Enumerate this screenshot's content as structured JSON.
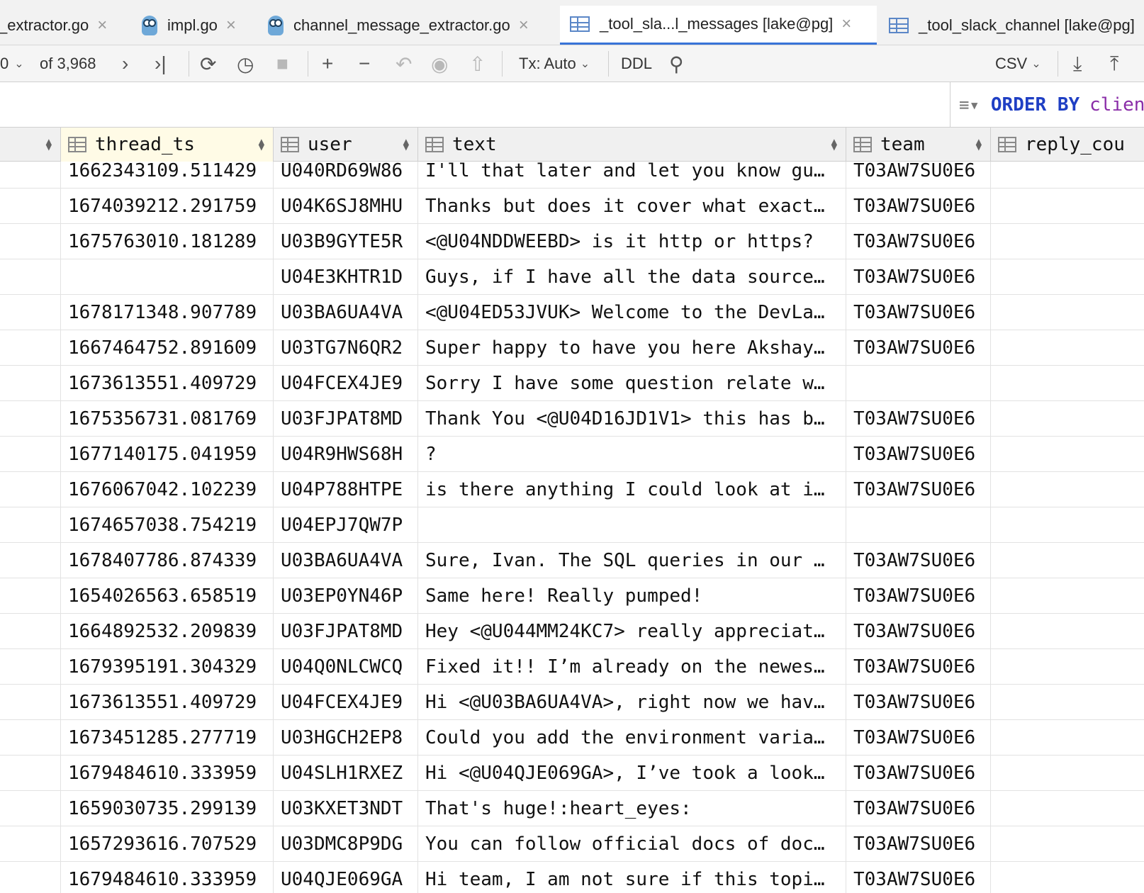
{
  "tabs": [
    {
      "label": "_extractor.go",
      "icon": "file-icon",
      "active": false
    },
    {
      "label": "impl.go",
      "icon": "gopher-icon",
      "active": false
    },
    {
      "label": "channel_message_extractor.go",
      "icon": "gopher-icon",
      "active": false
    },
    {
      "label": "_tool_sla...l_messages [lake@pg]",
      "icon": "table-icon",
      "active": true
    },
    {
      "label": "_tool_slack_channel [lake@pg]",
      "icon": "table-icon",
      "active": false
    }
  ],
  "toolbar": {
    "page_value": "0",
    "page_total": "of 3,968",
    "tx_label": "Tx: Auto",
    "ddl_label": "DDL",
    "export_format": "CSV"
  },
  "filter": {
    "order_by_keyword": "ORDER BY",
    "order_by_column": "clien"
  },
  "columns": [
    "thread_ts",
    "user",
    "text",
    "team",
    "reply_cou"
  ],
  "rows": [
    {
      "thread_ts": "1662343109.511429",
      "user": "U040RD69W86",
      "text": "I'll that later and let you know gu…",
      "team": "T03AW7SU0E6"
    },
    {
      "thread_ts": "1674039212.291759",
      "user": "U04K6SJ8MHU",
      "text": "Thanks but does it cover what exact…",
      "team": "T03AW7SU0E6"
    },
    {
      "thread_ts": "1675763010.181289",
      "user": "U03B9GYTE5R",
      "text": "<@U04NDDWEEBD> is it http or https?",
      "team": "T03AW7SU0E6"
    },
    {
      "thread_ts": "",
      "user": "U04E3KHTR1D",
      "text": "Guys, if I have all the data source…",
      "team": "T03AW7SU0E6"
    },
    {
      "thread_ts": "1678171348.907789",
      "user": "U03BA6UA4VA",
      "text": "<@U04ED53JVUK> Welcome to the DevLa…",
      "team": "T03AW7SU0E6"
    },
    {
      "thread_ts": "1667464752.891609",
      "user": "U03TG7N6QR2",
      "text": "Super happy to have you here Akshay…",
      "team": "T03AW7SU0E6"
    },
    {
      "thread_ts": "1673613551.409729",
      "user": "U04FCEX4JE9",
      "text": "Sorry I have some question relate w…",
      "team": ""
    },
    {
      "thread_ts": "1675356731.081769",
      "user": "U03FJPAT8MD",
      "text": "Thank You <@U04D16JD1V1> this has b…",
      "team": "T03AW7SU0E6"
    },
    {
      "thread_ts": "1677140175.041959",
      "user": "U04R9HWS68H",
      "text": "?",
      "team": "T03AW7SU0E6"
    },
    {
      "thread_ts": "1676067042.102239",
      "user": "U04P788HTPE",
      "text": "is there anything I could look at i…",
      "team": "T03AW7SU0E6"
    },
    {
      "thread_ts": "1674657038.754219",
      "user": "U04EPJ7QW7P",
      "text": "",
      "team": ""
    },
    {
      "thread_ts": "1678407786.874339",
      "user": "U03BA6UA4VA",
      "text": "Sure, Ivan. The SQL queries in our …",
      "team": "T03AW7SU0E6"
    },
    {
      "thread_ts": "1654026563.658519",
      "user": "U03EP0YN46P",
      "text": "Same here! Really pumped!",
      "team": "T03AW7SU0E6"
    },
    {
      "thread_ts": "1664892532.209839",
      "user": "U03FJPAT8MD",
      "text": "Hey <@U044MM24KC7> really appreciat…",
      "team": "T03AW7SU0E6"
    },
    {
      "thread_ts": "1679395191.304329",
      "user": "U04Q0NLCWCQ",
      "text": "Fixed it!! I’m already on the newes…",
      "team": "T03AW7SU0E6"
    },
    {
      "thread_ts": "1673613551.409729",
      "user": "U04FCEX4JE9",
      "text": "Hi <@U03BA6UA4VA>, right now we hav…",
      "team": "T03AW7SU0E6"
    },
    {
      "thread_ts": "1673451285.277719",
      "user": "U03HGCH2EP8",
      "text": "Could you add the environment varia…",
      "team": "T03AW7SU0E6"
    },
    {
      "thread_ts": "1679484610.333959",
      "user": "U04SLH1RXEZ",
      "text": "Hi <@U04QJE069GA>, I’ve took a look…",
      "team": "T03AW7SU0E6"
    },
    {
      "thread_ts": "1659030735.299139",
      "user": "U03KXET3NDT",
      "text": "That's huge!:heart_eyes:",
      "team": "T03AW7SU0E6"
    },
    {
      "thread_ts": "1657293616.707529",
      "user": "U03DMC8P9DG",
      "text": "You can follow official docs of doc…",
      "team": "T03AW7SU0E6"
    },
    {
      "thread_ts": "1679484610.333959",
      "user": "U04QJE069GA",
      "text": "Hi team, I am not sure if this topi…",
      "team": "T03AW7SU0E6"
    }
  ],
  "colors": {
    "accent": "#3874d8",
    "keyword": "#1f3fc4",
    "identifier": "#8a2da8",
    "sorted_header": "#fffbe6"
  }
}
